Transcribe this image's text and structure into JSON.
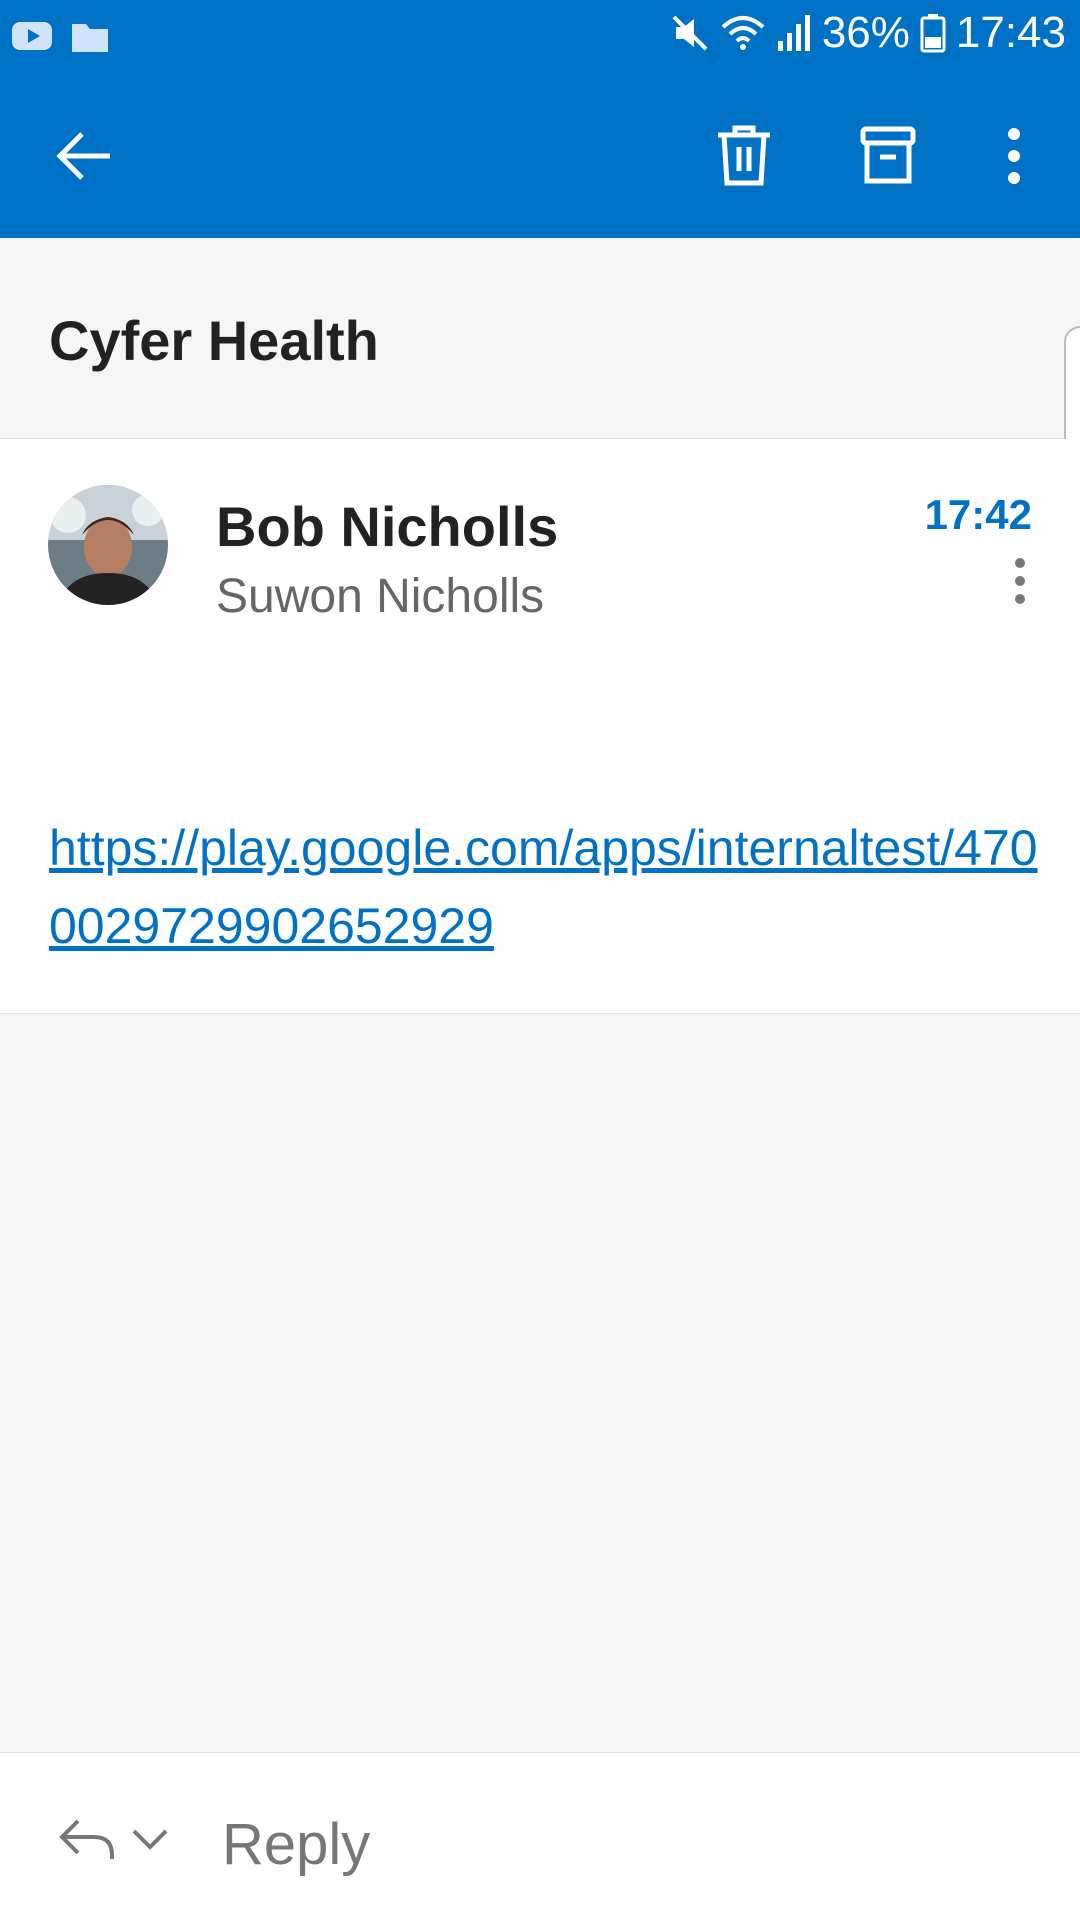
{
  "status_bar": {
    "battery": "36%",
    "time": "17:43",
    "icons": [
      "youtube-icon",
      "folder-icon",
      "mute-icon",
      "wifi-icon",
      "signal-icon",
      "battery-icon"
    ]
  },
  "toolbar": {
    "back_icon": "arrow-left-icon",
    "delete_icon": "trash-icon",
    "archive_icon": "archive-icon",
    "more_icon": "more-vertical-icon"
  },
  "email": {
    "subject": "Cyfer Health",
    "sender": "Bob Nicholls",
    "recipient": "Suwon Nicholls",
    "time": "17:42",
    "body_link": "https://play.google.com/apps/internaltest/4700029729902652929"
  },
  "reply_bar": {
    "label": "Reply"
  },
  "colors": {
    "accent": "#0072c6",
    "background": "#f6f6f6"
  }
}
